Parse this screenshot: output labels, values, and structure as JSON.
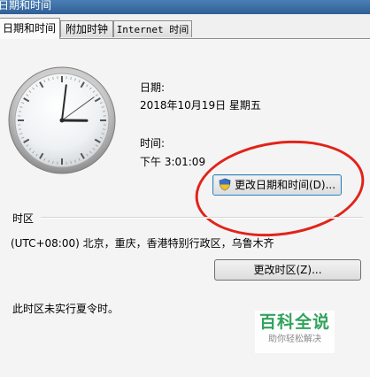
{
  "window": {
    "title": "日期和时间"
  },
  "tabs": [
    {
      "label": "日期和时间",
      "active": true
    },
    {
      "label": "附加时钟",
      "active": false
    },
    {
      "label": "Internet 时间",
      "active": false
    }
  ],
  "datetime": {
    "date_label": "日期:",
    "date_value": "2018年10月19日 星期五",
    "time_label": "时间:",
    "time_value": "下午 3:01:09",
    "change_button": "更改日期和时间(D)...",
    "change_button_icon": "uac-shield-icon",
    "clock": {
      "hour": 3,
      "minute": 1,
      "second": 9
    }
  },
  "timezone": {
    "section_label": "时区",
    "value": "(UTC+08:00) 北京，重庆，香港特别行政区，乌鲁木齐",
    "change_button": "更改时区(Z)...",
    "dst_note": "此时区未实行夏令时。"
  },
  "watermark": {
    "title": "百科全说",
    "subtitle": "助你轻松解决"
  },
  "annotation": {
    "ring_color": "#e2231a"
  }
}
